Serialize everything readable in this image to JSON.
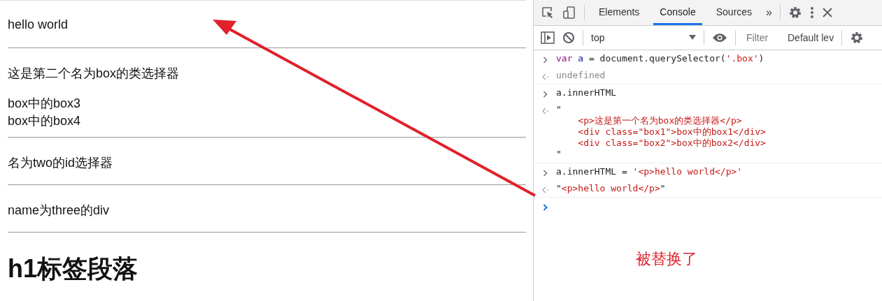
{
  "page": {
    "blocks": [
      {
        "kind": "text",
        "lines": [
          "hello world"
        ]
      },
      {
        "kind": "rule"
      },
      {
        "kind": "text",
        "lines": [
          "这是第二个名为box的类选择器"
        ]
      },
      {
        "kind": "text",
        "lines": [
          "box中的box3",
          "box中的box4"
        ]
      },
      {
        "kind": "rule"
      },
      {
        "kind": "text",
        "lines": [
          "名为two的id选择器"
        ]
      },
      {
        "kind": "rule"
      },
      {
        "kind": "text",
        "lines": [
          "name为three的div"
        ]
      },
      {
        "kind": "rule"
      },
      {
        "kind": "heading",
        "lines": [
          "h1标签段落"
        ]
      }
    ]
  },
  "devtools": {
    "tabs": [
      {
        "label": "Elements",
        "selected": false
      },
      {
        "label": "Console",
        "selected": true
      },
      {
        "label": "Sources",
        "selected": false
      }
    ],
    "more_tabs": "»",
    "context": "top",
    "filter": {
      "placeholder": "Filter"
    },
    "levels": "Default lev",
    "groups": [
      {
        "entries": [
          {
            "kind": "input",
            "lines": [
              [
                {
                  "kind": "keyword",
                  "text": "var"
                },
                {
                  "kind": "variable",
                  "text": " a"
                },
                {
                  "kind": "plain",
                  "text": " = document.querySelector("
                },
                {
                  "kind": "string",
                  "text": "'.box'"
                },
                {
                  "kind": "plain",
                  "text": ")"
                }
              ]
            ]
          },
          {
            "kind": "output",
            "lines": [
              [
                {
                  "kind": "muted",
                  "text": "undefined"
                }
              ]
            ]
          }
        ]
      },
      {
        "entries": [
          {
            "kind": "input",
            "lines": [
              [
                {
                  "kind": "plain",
                  "text": "a.innerHTML"
                }
              ]
            ]
          },
          {
            "kind": "output",
            "lines": [
              [
                {
                  "kind": "plain",
                  "text": "\""
                }
              ],
              [
                {
                  "kind": "markup",
                  "text": "    <p>这是第一个名为box的类选择器</p>"
                }
              ],
              [
                {
                  "kind": "markup",
                  "text": "    <div class=\"box1\">box中的box1</div>"
                }
              ],
              [
                {
                  "kind": "markup",
                  "text": "    <div class=\"box2\">box中的box2</div>"
                }
              ],
              [
                {
                  "kind": "plain",
                  "text": "\""
                }
              ]
            ]
          }
        ]
      },
      {
        "entries": [
          {
            "kind": "input",
            "lines": [
              [
                {
                  "kind": "plain",
                  "text": "a.innerHTML = "
                },
                {
                  "kind": "string",
                  "text": "'<p>hello world</p>'"
                }
              ]
            ]
          },
          {
            "kind": "output",
            "lines": [
              [
                {
                  "kind": "plain",
                  "text": "\""
                },
                {
                  "kind": "markup",
                  "text": "<p>hello world</p>"
                },
                {
                  "kind": "plain",
                  "text": "\""
                }
              ]
            ]
          }
        ]
      },
      {
        "entries": [
          {
            "kind": "prompt"
          }
        ]
      }
    ]
  },
  "annotation": "被替换了"
}
